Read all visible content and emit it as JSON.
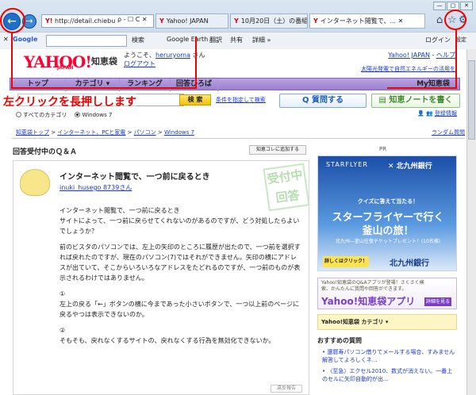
{
  "browser": {
    "address": "http://detail.chiebuk...",
    "address_icons": "ρ - ☐ C ✕",
    "tabs": [
      {
        "label": "Yahoo! JAPAN",
        "active": false
      },
      {
        "label": "10月20日（土）の番組表[...",
        "active": false
      },
      {
        "label": "インターネット閲覧で、...",
        "active": true
      }
    ],
    "tab_close": "✕",
    "win_buttons": [
      "—",
      "▢",
      "✕"
    ],
    "toolbar": {
      "close": "✕",
      "google": "Google",
      "search_btn": "検索",
      "earth": "Google Earth",
      "translate": "翻訳",
      "share": "共有",
      "detail": "詳細 »",
      "login": "ログイン",
      "settings": "設定"
    }
  },
  "header": {
    "logo": "YAHOO!",
    "logo_sub": "JAPAN",
    "service": "知恵袋",
    "welcome_prefix": "ようこそ、",
    "username": "heruryoma",
    "welcome_suffix": " さん",
    "logout": "ログアウト",
    "top_link": "Yahoo! JAPAN",
    "help": "ヘルプ",
    "pv": "太陽光発電で自然エネルギーの活用を"
  },
  "nav": [
    "トップ",
    "カテゴリ ▾",
    "ランキング",
    "回答ひろば",
    "My知恵袋"
  ],
  "search": {
    "button": "検 索",
    "cond": "条件を指定して検索",
    "ask": "質問する",
    "note": "知恵ノートを書く",
    "radio_all": "すべてのカテゴリ",
    "radio_win": "Windows 7",
    "register": "登録情報"
  },
  "annotation": "左クリックを長押しします",
  "breadcrumb": [
    "知恵袋トップ",
    "インターネット、PCと家電",
    "パソコン",
    "Windows 7"
  ],
  "breadcrumb_sep": ">",
  "random": "ランダム質問",
  "section_title": "回答受付中のＱ＆Ａ",
  "fav_button": "知恵コレに追加する",
  "pr": "PR",
  "question": {
    "title": "インターネット閲覧で、一つ前に戻るとき",
    "user": "inuki_husego 8739さん",
    "stamp": "受付中 回答",
    "paragraphs": [
      "インターネット閲覧で、一つ前に戻るとき",
      "サイトによって、一つ前に戻らせてくれないのがあるのですが、どう対処したらよいでしょうか？",
      "前のビスタのパソコンでは、左上の矢印のところに履歴が出たので、一つ前を選択すれば戻れたのですが、現在のパソコン(7)ではそれができません。矢印の横にアドレスが出ていて、そこからいろいろなアドレスをたどれるのですが、一つ前のものが表示されるわけではありません。",
      "①",
      "左上の戻る「←」ボタンの横に今まであった小さいボタンで、一つ以上前のページに戻るやつは表示できないのか。",
      "②",
      "そもそも、戻れなくするサイトの、戻れなくする行為を無効化できないか。"
    ],
    "violate": "違反報告"
  },
  "ad": {
    "brand": "STARFLYER",
    "bank": "✕ 北九州銀行",
    "quiz": "クイズに答えて当たる！",
    "big1": "スターフライヤーで行く",
    "big2": "釜山の旅！",
    "sub": "北九州―釜山往復チケットプレゼント！(10名様)",
    "click": "詳しくはクリック！",
    "bank2": "北九州銀行"
  },
  "appad": {
    "text": "Yahoo!知恵袋のQ&Aアプリが登場！さくさく検索、かんたんに質問や回答ができます。",
    "title": "Yahoo!知恵袋アプリ",
    "detail": "詳細を見る"
  },
  "category": "Yahoo!知恵袋 カテゴリ ▾",
  "recommend": {
    "title": "おすすめの質問",
    "items": [
      "• 還暦寿パソコン借りてメールする場合、すみません解答してよろしくネ...",
      "• 〈至急〉エクセル2010、数式が消えない。一番上のセルに矢印自動的が出..."
    ]
  },
  "colors": {
    "red": "#e00000",
    "purple": "#9b7fd0",
    "yahoo": "#ff0033",
    "link": "#1a3acb"
  }
}
